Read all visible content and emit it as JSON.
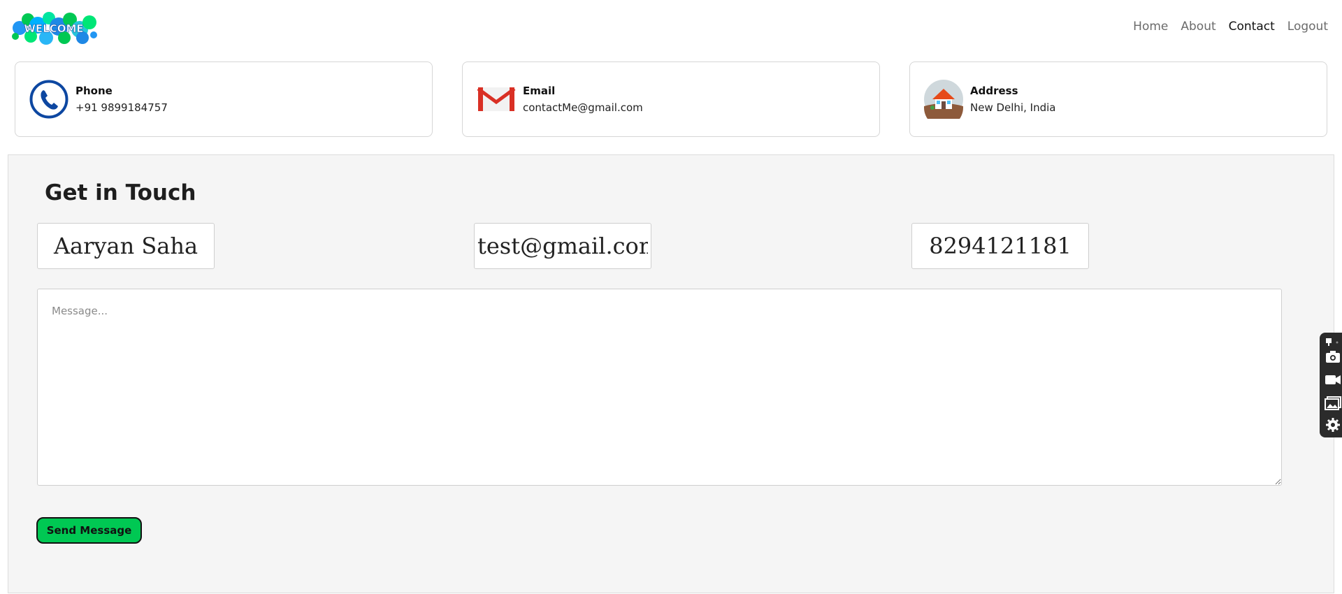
{
  "header": {
    "logo_text": "WELCOME",
    "nav": [
      {
        "label": "Home"
      },
      {
        "label": "About"
      },
      {
        "label": "Contact",
        "active": true
      },
      {
        "label": "Logout"
      }
    ]
  },
  "cards": [
    {
      "title": "Phone",
      "value": "+91 9899184757",
      "icon": "phone-icon"
    },
    {
      "title": "Email",
      "value": "contactMe@gmail.com",
      "icon": "gmail-icon"
    },
    {
      "title": "Address",
      "value": "New Delhi, India",
      "icon": "house-icon"
    }
  ],
  "form": {
    "heading": "Get in Touch",
    "name_value": "Aaryan Saha",
    "email_value": "test@gmail.com",
    "phone_value": "8294121181",
    "message_placeholder": "Message...",
    "submit_label": "Send Message"
  },
  "side_toolbar": {
    "icons": [
      "pin-icon",
      "camera-icon",
      "video-icon",
      "gallery-icon",
      "settings-icon"
    ]
  },
  "colors": {
    "accent_button": "#00c853",
    "panel_bg": "#f5f5f5"
  }
}
